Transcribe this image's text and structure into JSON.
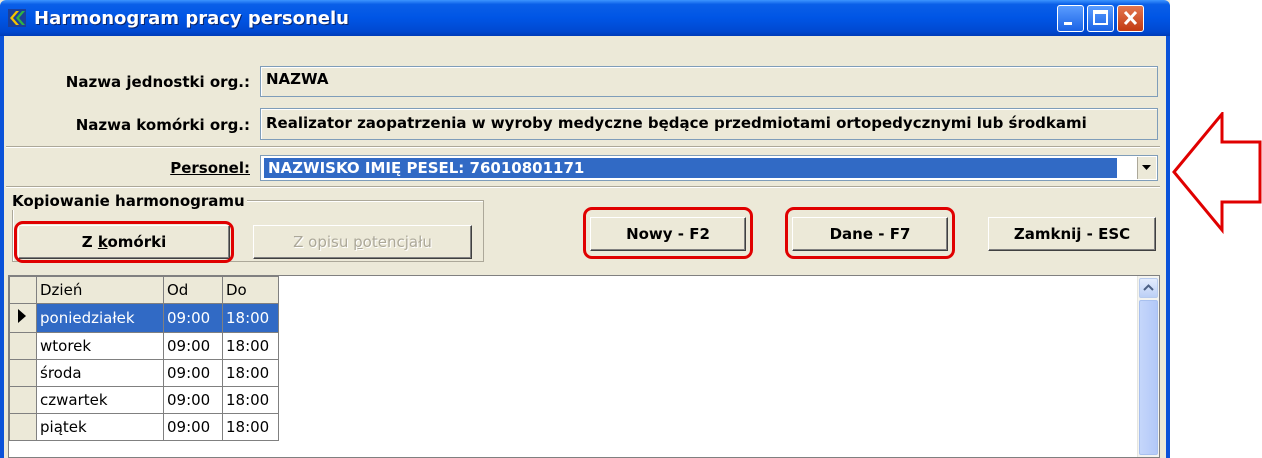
{
  "window": {
    "title": "Harmonogram pracy personelu"
  },
  "form": {
    "unit_label": "Nazwa jednostki org.:",
    "unit_value": "NAZWA",
    "cell_label": "Nazwa komórki org.:",
    "cell_value": "Realizator zaopatrzenia w wyroby medyczne będące przedmiotami ortopedycznymi lub środkami",
    "staff_label": "Personel:",
    "staff_value": "NAZWISKO IMIĘ PESEL: 76010801171"
  },
  "copy_group": {
    "title": "Kopiowanie harmonogramu",
    "from_cell_prefix": "Z ",
    "from_cell_underlined": "k",
    "from_cell_rest": "omórki",
    "from_potential_prefix": "Z opisu ",
    "from_potential_underlined": "p",
    "from_potential_rest": "otencjału"
  },
  "actions": {
    "new_label": "Nowy - F2",
    "data_label": "Dane - F7",
    "close_label": "Zamknij - ESC"
  },
  "grid": {
    "headers": [
      "Dzień",
      "Od",
      "Do"
    ],
    "rows": [
      {
        "day": "poniedziałek",
        "from": "09:00",
        "to": "18:00"
      },
      {
        "day": "wtorek",
        "from": "09:00",
        "to": "18:00"
      },
      {
        "day": "środa",
        "from": "09:00",
        "to": "18:00"
      },
      {
        "day": "czwartek",
        "from": "09:00",
        "to": "18:00"
      },
      {
        "day": "piątek",
        "from": "09:00",
        "to": "18:00"
      }
    ],
    "selected_row": 0
  },
  "annotation_colors": {
    "highlight": "#e00000",
    "selection": "#316ac5"
  }
}
